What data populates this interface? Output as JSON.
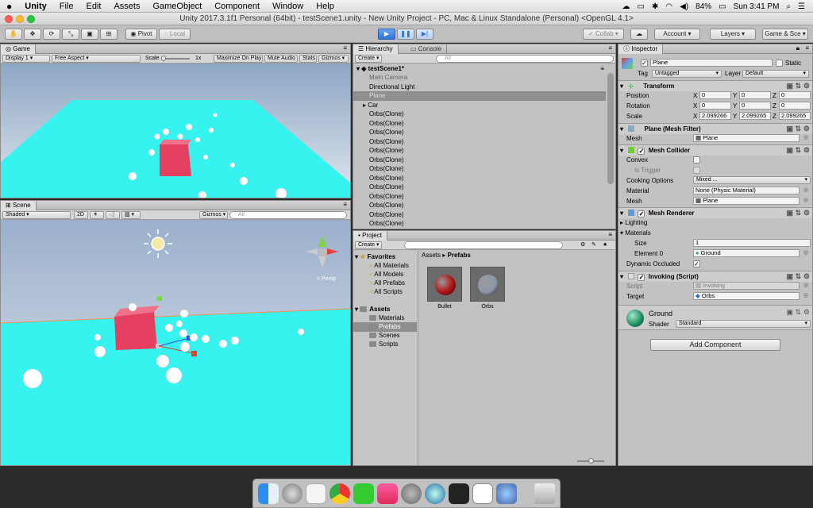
{
  "menubar": {
    "apple_icon": "apple-icon",
    "app": "Unity",
    "items": [
      "File",
      "Edit",
      "Assets",
      "GameObject",
      "Component",
      "Window",
      "Help"
    ],
    "battery": "84%",
    "clock": "Sun 3:41 PM"
  },
  "window": {
    "title": "Unity 2017.3.1f1 Personal (64bit) - testScene1.unity - New Unity Project - PC, Mac & Linux Standalone (Personal) <OpenGL 4.1>"
  },
  "toolbar": {
    "pivot": "Pivot",
    "local": "Local",
    "collab": "Collab",
    "account": "Account",
    "layers": "Layers",
    "layout": "Game & Sce"
  },
  "game": {
    "tab": "Game",
    "display": "Display 1",
    "aspect": "Free Aspect",
    "scale_label": "Scale",
    "scale_value": "1x",
    "maximize": "Maximize On Play",
    "mute": "Mute Audio",
    "stats": "Stats",
    "gizmos": "Gizmos"
  },
  "scene": {
    "tab": "Scene",
    "shading": "Shaded",
    "mode2d": "2D",
    "gizmos": "Gizmos",
    "search": "All",
    "persp": "< Persp"
  },
  "hierarchy": {
    "tab": "Hierarchy",
    "tab2": "Console",
    "create": "Create",
    "search": "All",
    "scene": "testScene1*",
    "items": [
      {
        "label": "Main Camera",
        "style": "dim"
      },
      {
        "label": "Directional Light",
        "style": ""
      },
      {
        "label": "Plane",
        "style": "sel"
      },
      {
        "label": "Car",
        "style": ""
      },
      {
        "label": "Orbs(Clone)",
        "style": ""
      },
      {
        "label": "Orbs(Clone)",
        "style": ""
      },
      {
        "label": "Orbs(Clone)",
        "style": ""
      },
      {
        "label": "Orbs(Clone)",
        "style": ""
      },
      {
        "label": "Orbs(Clone)",
        "style": ""
      },
      {
        "label": "Orbs(Clone)",
        "style": ""
      },
      {
        "label": "Orbs(Clone)",
        "style": ""
      },
      {
        "label": "Orbs(Clone)",
        "style": ""
      },
      {
        "label": "Orbs(Clone)",
        "style": ""
      },
      {
        "label": "Orbs(Clone)",
        "style": ""
      },
      {
        "label": "Orbs(Clone)",
        "style": ""
      },
      {
        "label": "Orbs(Clone)",
        "style": ""
      },
      {
        "label": "Orbs(Clone)",
        "style": ""
      }
    ]
  },
  "project": {
    "tab": "Project",
    "create": "Create",
    "favorites": "Favorites",
    "fav_items": [
      "All Materials",
      "All Models",
      "All Prefabs",
      "All Scripts"
    ],
    "assets": "Assets",
    "asset_folders": [
      "Materials",
      "Prefabs",
      "Scenes",
      "Scripts"
    ],
    "breadcrumb_root": "Assets",
    "breadcrumb_sep": "▸",
    "breadcrumb_leaf": "Prefabs",
    "prefabs": [
      {
        "label": "Bullet",
        "color": "#b01010"
      },
      {
        "label": "Orbs",
        "color": "#8d96a8"
      }
    ]
  },
  "inspector": {
    "tab": "Inspector",
    "name": "Plane",
    "static": "Static",
    "tag_label": "Tag",
    "tag": "Untagged",
    "layer_label": "Layer",
    "layer": "Default",
    "transform": {
      "title": "Transform",
      "position": "Position",
      "rotation": "Rotation",
      "scale": "Scale",
      "x": "X",
      "y": "Y",
      "z": "Z",
      "pos": [
        "0",
        "0",
        "0"
      ],
      "rot": [
        "0",
        "0",
        "0"
      ],
      "scl": [
        "2.099266",
        "2.099265",
        "2.099265"
      ]
    },
    "mesh_filter": {
      "title": "Plane (Mesh Filter)",
      "mesh_label": "Mesh",
      "mesh": "Plane"
    },
    "mesh_collider": {
      "title": "Mesh Collider",
      "convex": "Convex",
      "trigger": "Is Trigger",
      "cooking_label": "Cooking Options",
      "cooking": "Mixed ...",
      "material_label": "Material",
      "material": "None (Physic Material)",
      "mesh_label": "Mesh",
      "mesh": "Plane"
    },
    "mesh_renderer": {
      "title": "Mesh Renderer",
      "lighting": "Lighting",
      "materials": "Materials",
      "size_label": "Size",
      "size": "1",
      "element_label": "Element 0",
      "element": "Ground",
      "occluded": "Dynamic Occluded"
    },
    "invoking": {
      "title": "Invoking (Script)",
      "script_label": "Script",
      "script": "Invoking",
      "target_label": "Target",
      "target": "Orbs"
    },
    "material": {
      "name": "Ground",
      "shader_label": "Shader",
      "shader": "Standard"
    },
    "add_component": "Add Component"
  }
}
